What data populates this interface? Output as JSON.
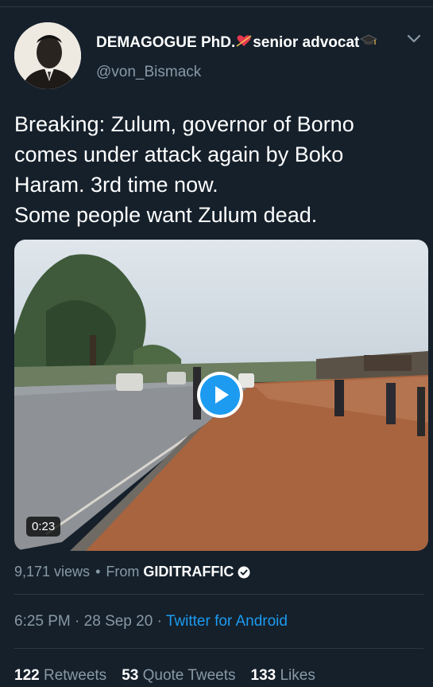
{
  "author": {
    "display_name_part1": "DEMAGOGUE PhD.",
    "display_name_part2": "senior advocat",
    "name_icons": [
      "heart-arrow-icon",
      "graduation-cap-icon"
    ],
    "handle": "@von_Bismack"
  },
  "tweet": {
    "lines": [
      "Breaking: Zulum, governor of Borno",
      "comes under attack again by Boko",
      "Haram. 3rd time now.",
      "Some people want Zulum dead."
    ]
  },
  "video": {
    "duration": "0:23",
    "play_icon": "play-icon"
  },
  "meta": {
    "views": "9,171 views",
    "separator": "•",
    "from_label": "From",
    "source": "GIDITRAFFIC",
    "source_badge_icon": "verified-badge-icon"
  },
  "timestamp": {
    "time": "6:25 PM",
    "separator": "·",
    "date": "28 Sep 20",
    "client": "Twitter for Android"
  },
  "stats": {
    "retweets_count": "122",
    "retweets_label": "Retweets",
    "quotes_count": "53",
    "quotes_label": "Quote Tweets",
    "likes_count": "133",
    "likes_label": "Likes"
  },
  "colors": {
    "background": "#15202b",
    "text_primary": "#ffffff",
    "text_secondary": "#8899a6",
    "accent": "#1d9bf0",
    "divider": "#2b3742"
  }
}
